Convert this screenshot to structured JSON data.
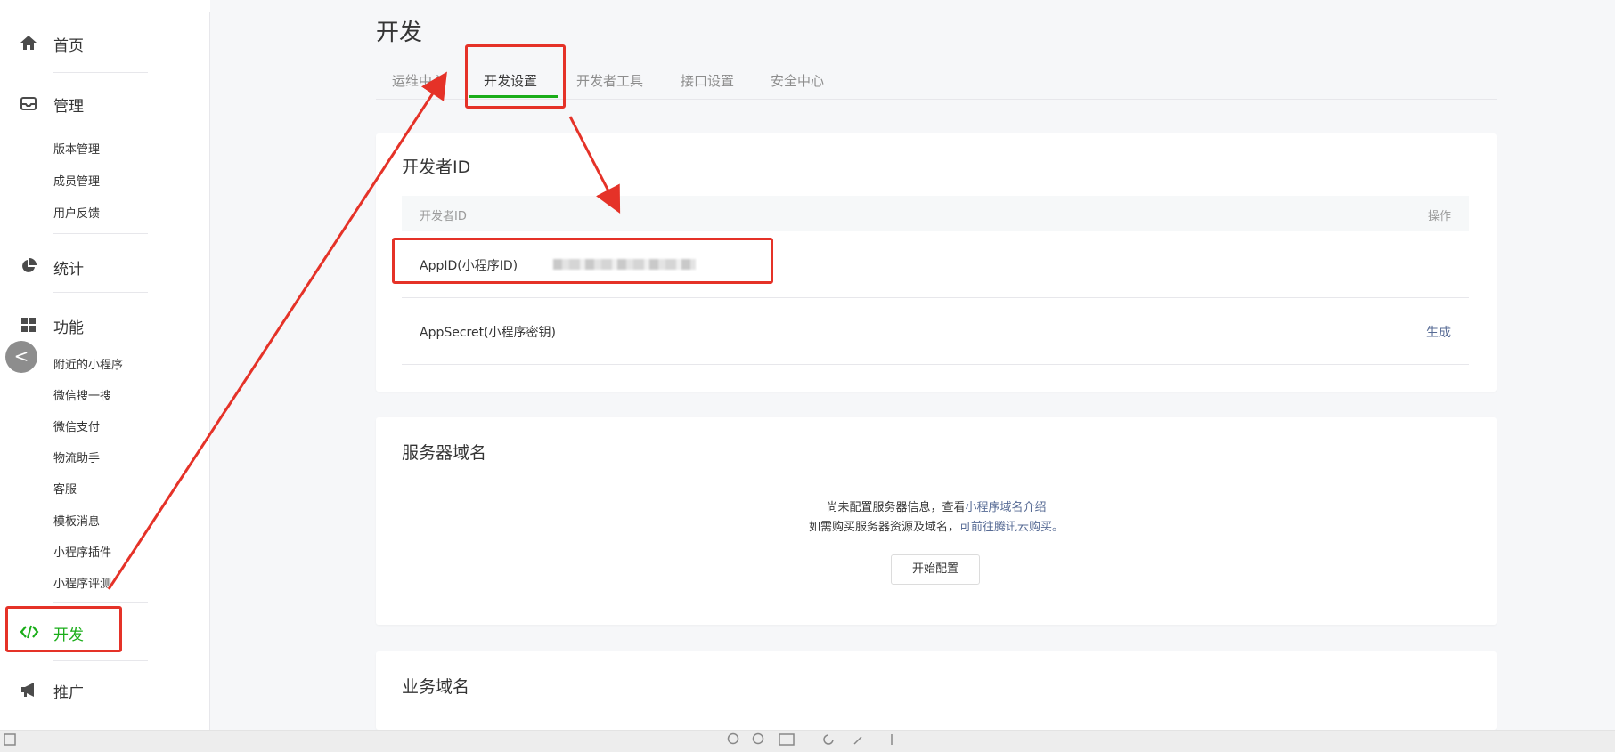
{
  "sidebar": {
    "home": "首页",
    "manage": "管理",
    "manage_items": [
      "版本管理",
      "成员管理",
      "用户反馈"
    ],
    "stats": "统计",
    "features": "功能",
    "feature_items": [
      "附近的小程序",
      "微信搜一搜",
      "微信支付",
      "物流助手",
      "客服",
      "模板消息",
      "小程序插件",
      "小程序评测"
    ],
    "develop": "开发",
    "promote": "推广",
    "collapse_glyph": "<"
  },
  "page": {
    "title": "开发",
    "tabs": [
      "运维中心",
      "开发设置",
      "开发者工具",
      "接口设置",
      "安全中心"
    ],
    "active_tab": "开发设置"
  },
  "dev_id_card": {
    "title": "开发者ID",
    "col_name": "开发者ID",
    "col_action": "操作",
    "rows": [
      {
        "label": "AppID(小程序ID)",
        "action": ""
      },
      {
        "label": "AppSecret(小程序密钥)",
        "action": "生成"
      }
    ]
  },
  "server_card": {
    "title": "服务器域名",
    "note_prefix": "尚未配置服务器信息，查看",
    "note_link": "小程序域名介绍",
    "buy_prefix": "如需购买服务器资源及域名，",
    "buy_link": "可前往腾讯云购买。",
    "button": "开始配置"
  },
  "biz_card": {
    "title": "业务域名"
  },
  "colors": {
    "accent_green": "#1aad19",
    "link_blue": "#576b95",
    "annotation_red": "#e53228"
  }
}
